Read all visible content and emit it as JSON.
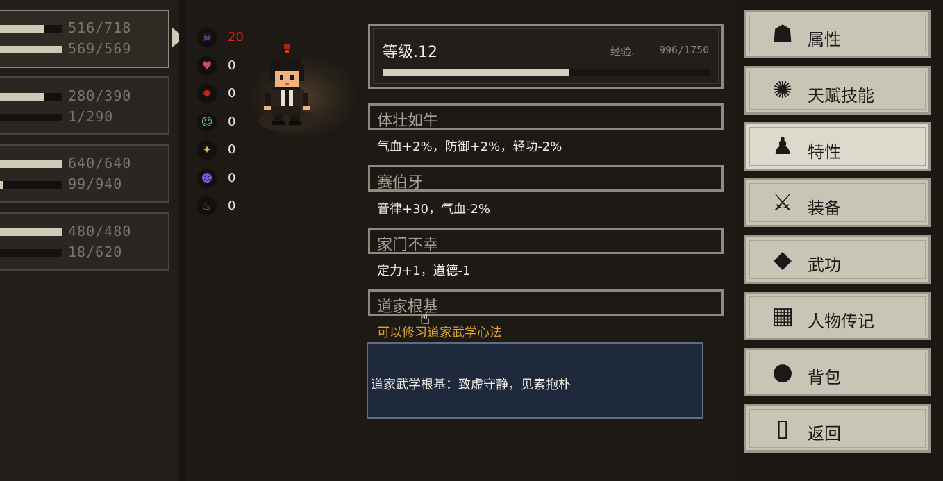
{
  "left_stats": [
    {
      "rows": [
        {
          "value": "516/718",
          "fill": 0.72
        },
        {
          "value": "569/569",
          "fill": 1.0
        }
      ]
    },
    {
      "rows": [
        {
          "value": "280/390",
          "fill": 0.72
        },
        {
          "value": "1/290",
          "fill": 0.0
        }
      ]
    },
    {
      "rows": [
        {
          "value": "640/640",
          "fill": 1.0
        },
        {
          "value": "99/940",
          "fill": 0.1
        }
      ]
    },
    {
      "rows": [
        {
          "value": "480/480",
          "fill": 1.0
        },
        {
          "value": "18/620",
          "fill": 0.03
        }
      ]
    }
  ],
  "effects": [
    {
      "icon": "purple-skull-icon",
      "glyph": "☠",
      "color": "#8a5cf0",
      "value": "20",
      "highlight": true
    },
    {
      "icon": "broken-heart-icon",
      "glyph": "♥",
      "color": "#d24a6a",
      "value": "0"
    },
    {
      "icon": "red-bug-icon",
      "glyph": "✹",
      "color": "#c8281e",
      "value": "0"
    },
    {
      "icon": "teal-face-icon",
      "glyph": "☺",
      "color": "#5fcfb8",
      "value": "0"
    },
    {
      "icon": "golden-star-icon",
      "glyph": "✦",
      "color": "#e2c25a",
      "value": "0"
    },
    {
      "icon": "purple-mask-icon",
      "glyph": "☻",
      "color": "#6a5ae6",
      "value": "0"
    },
    {
      "icon": "fire-icon",
      "glyph": "♨",
      "color": "#e24a2a",
      "value": "0"
    }
  ],
  "level": {
    "label": "等级.12",
    "exp_label": "经验.",
    "exp_value": "996/1750",
    "exp_fraction": 0.569
  },
  "traits": [
    {
      "name": "体壮如牛",
      "desc": "气血+2%，防御+2%，轻功-2%"
    },
    {
      "name": "赛伯牙",
      "desc": "音律+30，气血-2%"
    },
    {
      "name": "家门不幸",
      "desc": "定力+1，道德-1"
    },
    {
      "name": "道家根基",
      "desc": "可以修习道家武学心法"
    }
  ],
  "tooltip": "道家武学根基：致虚守静，见素抱朴",
  "menu": [
    {
      "label": "属性",
      "icon": "character-icon",
      "glyph": "☗"
    },
    {
      "label": "天赋技能",
      "icon": "talent-icon",
      "glyph": "✺"
    },
    {
      "label": "特性",
      "icon": "trait-icon",
      "glyph": "♟",
      "selected": true
    },
    {
      "label": "装备",
      "icon": "sword-icon",
      "glyph": "⚔"
    },
    {
      "label": "武功",
      "icon": "book-icon",
      "glyph": "◆"
    },
    {
      "label": "人物传记",
      "icon": "biography-icon",
      "glyph": "▦"
    },
    {
      "label": "背包",
      "icon": "bag-icon",
      "glyph": "●"
    },
    {
      "label": "返回",
      "icon": "door-icon",
      "glyph": "▯"
    }
  ],
  "colors": {
    "menu_bg": "#c8c4b6",
    "menu_selected": "#dcd9cd",
    "tooltip_bg": "#1e2a3c",
    "effect_highlight": "#e0261d",
    "trait_highlight": "#e3a532"
  }
}
